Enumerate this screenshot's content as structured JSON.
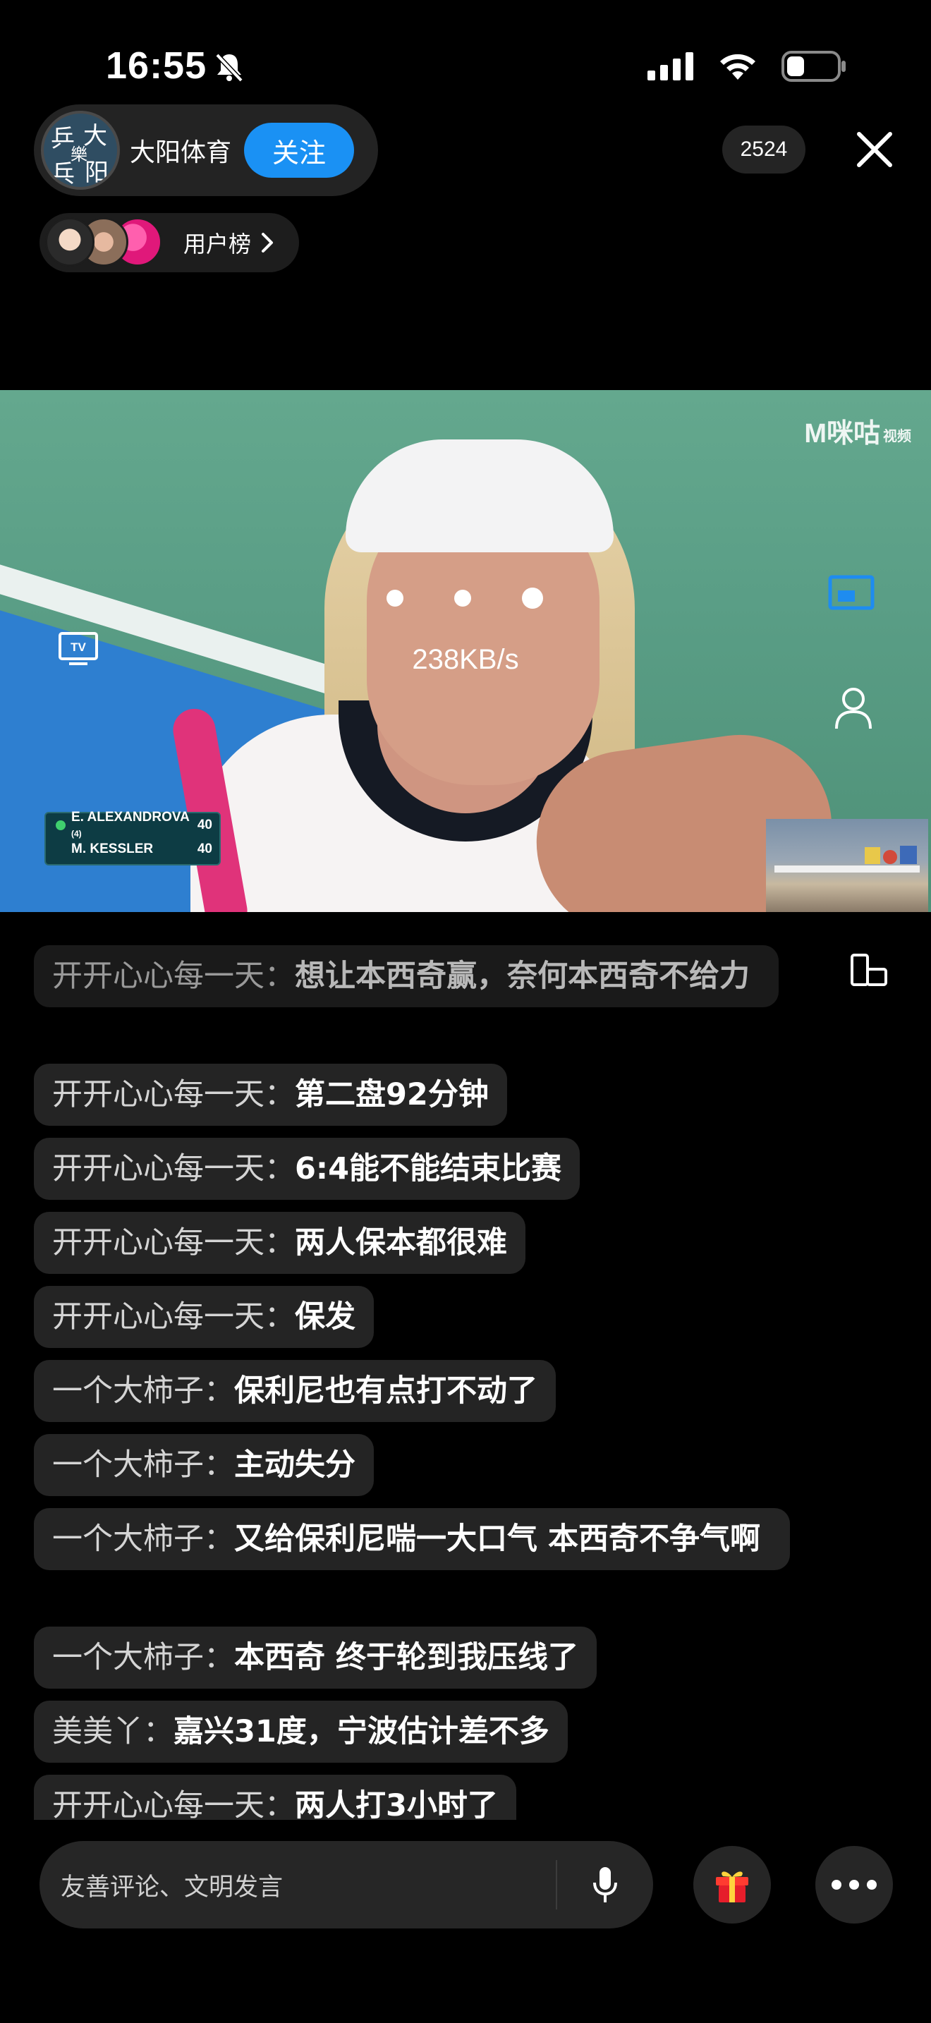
{
  "status_bar": {
    "time": "16:55",
    "icons": [
      "bell-muted-icon",
      "signal-icon",
      "wifi-icon",
      "battery-icon"
    ],
    "battery_level": 0.3
  },
  "header": {
    "streamer_name": "大阳体育",
    "avatar_glyphs": [
      "乒",
      "大",
      "樂",
      "乓",
      "阳"
    ],
    "follow_label": "关注",
    "viewer_count": "2524",
    "rank_label": "用户榜"
  },
  "video": {
    "logo_text": "M咪咕",
    "logo_sub": "视频",
    "network_speed": "238KB/s",
    "tv_label": "TV",
    "scoreboard": [
      {
        "name": "E. ALEXANDROVA",
        "seed": "(4)",
        "score": "40"
      },
      {
        "name": "M. KESSLER",
        "seed": "",
        "score": "40"
      }
    ]
  },
  "chat": {
    "messages": [
      {
        "user": "开开心心每一天：",
        "text": "想让本西奇赢，奈何本西奇不给力"
      },
      {
        "user": "开开心心每一天：",
        "text": "第二盘92分钟"
      },
      {
        "user": "开开心心每一天：",
        "text": "6:4能不能结束比赛"
      },
      {
        "user": "开开心心每一天：",
        "text": "两人保本都很难"
      },
      {
        "user": "开开心心每一天：",
        "text": "保发"
      },
      {
        "user": "一个大柿子：",
        "text": "保利尼也有点打不动了"
      },
      {
        "user": "一个大柿子：",
        "text": "主动失分"
      },
      {
        "user": "一个大柿子：",
        "text": "又给保利尼喘一大口气 本西奇不争气啊"
      },
      {
        "user": "一个大柿子：",
        "text": "本西奇 终于轮到我压线了"
      },
      {
        "user": "美美丫：",
        "text": "嘉兴31度，宁波估计差不多"
      },
      {
        "user": "开开心心每一天：",
        "text": "两人打3小时了"
      }
    ]
  },
  "bottom_bar": {
    "comment_placeholder": "友善评论、文明发言"
  },
  "colors": {
    "accent": "#1a91f4",
    "bubble": "#242424",
    "background": "#000000"
  }
}
